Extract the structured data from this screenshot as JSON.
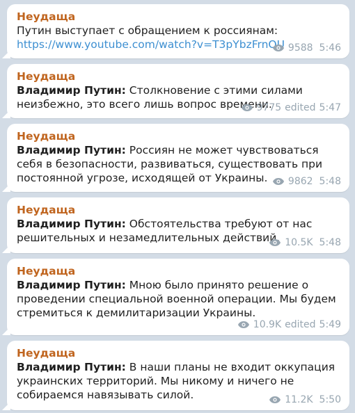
{
  "messages": [
    {
      "sender": "Неудаща",
      "text": "Путин выступает с обращением к россиянам:",
      "link": "https://www.youtube.com/watch?v=T3pYbzFrnQU",
      "views": "9588",
      "time": "5:46"
    },
    {
      "sender": "Неудаща",
      "speaker": "Владимир Путин:",
      "text": " Столкновение с этими силами неизбежно, это всего лишь вопрос времени.",
      "views": "9775",
      "edited": "edited",
      "time": "5:47"
    },
    {
      "sender": "Неудаща",
      "speaker": "Владимир Путин:",
      "text": " Россиян не может чувствоваться себя в безопасности, развиваться, существовать при постоянной угрозе, исходящей от Украины.",
      "views": "9862",
      "time": "5:48"
    },
    {
      "sender": "Неудаща",
      "speaker": "Владимир Путин:",
      "text": " Обстоятельства требуют от нас решительных и незамедлительных действий.",
      "views": "10.5K",
      "time": "5:48"
    },
    {
      "sender": "Неудаща",
      "speaker": "Владимир Путин:",
      "text": " Мною было принято решение о проведении специальной военной операции. Мы будем стремиться к демилитаризации Украины.",
      "views": "10.9K",
      "edited": "edited",
      "time": "5:49"
    },
    {
      "sender": "Неудаща",
      "speaker": "Владимир Путин:",
      "text": " В наши планы не входит оккупация украинских территорий. Мы никому и ничего не собираемся навязывать силой.",
      "views": "11.2K",
      "time": "5:50"
    }
  ],
  "icons": {
    "views": "eye-icon"
  },
  "colors": {
    "background": "#d3dce6",
    "bubble": "#ffffff",
    "sender": "#c0651f",
    "link": "#3d8fd1",
    "meta": "#98a6b1"
  }
}
